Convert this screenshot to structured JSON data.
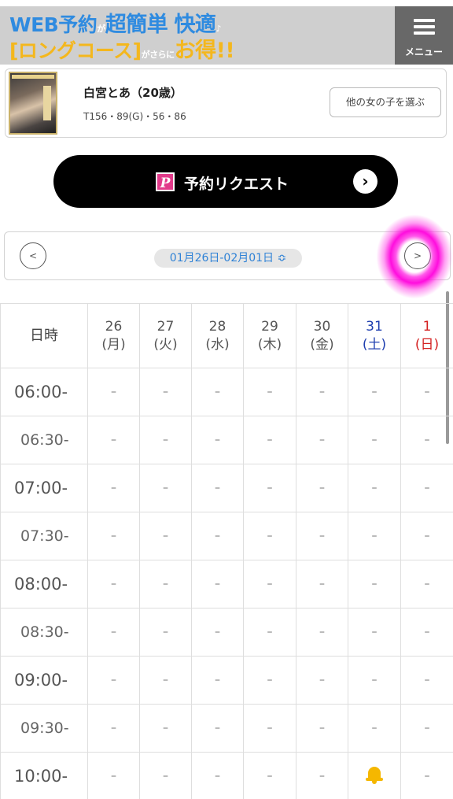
{
  "banner": {
    "line1_a": "WEB予約",
    "line1_b": "が",
    "line1_c": "超簡単",
    "line1_d": "快適",
    "line1_e": "♪",
    "line2_a": "[ロングコース]",
    "line2_b": "がさらに",
    "line2_c": "お得!!"
  },
  "menu": {
    "label": "メニュー"
  },
  "profile": {
    "name": "白宮とあ（20歳）",
    "stats": "T156・89(G)・56・86",
    "other_button": "他の女の子を選ぶ"
  },
  "request": {
    "icon_letter": "P",
    "label": "予約リクエスト"
  },
  "date_nav": {
    "prev": "<",
    "next": ">",
    "range": "01月26日-02月01日 ≎"
  },
  "schedule": {
    "corner": "日時",
    "days": [
      {
        "num": "26",
        "dow": "(月)"
      },
      {
        "num": "27",
        "dow": "(火)"
      },
      {
        "num": "28",
        "dow": "(水)"
      },
      {
        "num": "29",
        "dow": "(木)"
      },
      {
        "num": "30",
        "dow": "(金)"
      },
      {
        "num": "31",
        "dow": "(土)"
      },
      {
        "num": "1",
        "dow": "(日)"
      }
    ],
    "rows": [
      {
        "time": "06:00-",
        "cells": [
          "–",
          "–",
          "–",
          "–",
          "–",
          "–",
          "–"
        ]
      },
      {
        "time": "06:30-",
        "cells": [
          "–",
          "–",
          "–",
          "–",
          "–",
          "–",
          "–"
        ]
      },
      {
        "time": "07:00-",
        "cells": [
          "–",
          "–",
          "–",
          "–",
          "–",
          "–",
          "–"
        ]
      },
      {
        "time": "07:30-",
        "cells": [
          "–",
          "–",
          "–",
          "–",
          "–",
          "–",
          "–"
        ]
      },
      {
        "time": "08:00-",
        "cells": [
          "–",
          "–",
          "–",
          "–",
          "–",
          "–",
          "–"
        ]
      },
      {
        "time": "08:30-",
        "cells": [
          "–",
          "–",
          "–",
          "–",
          "–",
          "–",
          "–"
        ]
      },
      {
        "time": "09:00-",
        "cells": [
          "–",
          "–",
          "–",
          "–",
          "–",
          "–",
          "–"
        ]
      },
      {
        "time": "09:30-",
        "cells": [
          "–",
          "–",
          "–",
          "–",
          "–",
          "–",
          "–"
        ]
      },
      {
        "time": "10:00-",
        "cells": [
          "–",
          "–",
          "–",
          "–",
          "–",
          "bell-icon",
          "–"
        ]
      }
    ]
  }
}
